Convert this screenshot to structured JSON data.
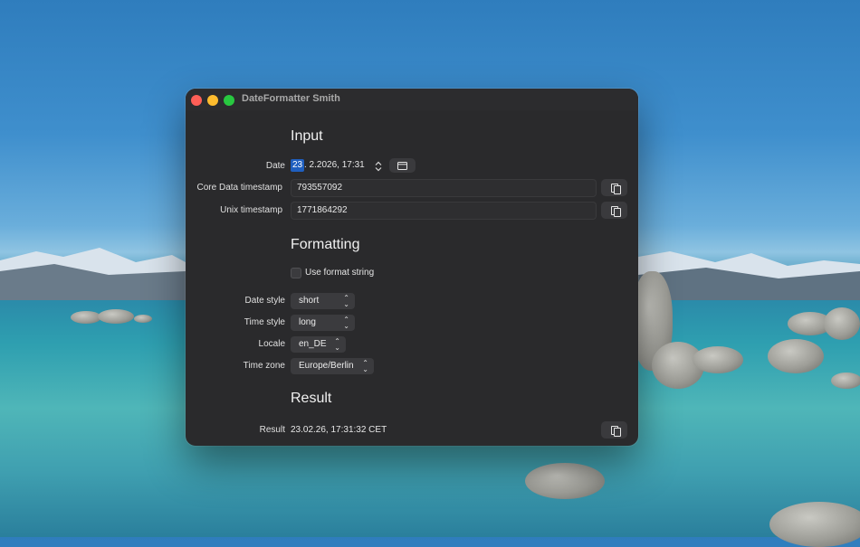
{
  "window": {
    "title": "DateFormatter Smith"
  },
  "input": {
    "heading": "Input",
    "date_label": "Date",
    "date_day": "23",
    "date_rest": ". 2.2026, 17:31",
    "core_data_label": "Core Data timestamp",
    "core_data_value": "793557092",
    "unix_label": "Unix timestamp",
    "unix_value": "1771864292"
  },
  "formatting": {
    "heading": "Formatting",
    "use_format_string_label": "Use format string",
    "use_format_string_checked": false,
    "date_style_label": "Date style",
    "date_style_value": "short",
    "time_style_label": "Time style",
    "time_style_value": "long",
    "locale_label": "Locale",
    "locale_value": "en_DE",
    "time_zone_label": "Time zone",
    "time_zone_value": "Europe/Berlin"
  },
  "result": {
    "heading": "Result",
    "label": "Result",
    "value": "23.02.26, 17:31:32 CET"
  },
  "colors": {
    "close": "#ff5f57",
    "minimize": "#febc2e",
    "maximize": "#28c840",
    "selection": "#1f5fbf"
  },
  "icons": [
    "calendar-icon",
    "copy-icon",
    "stepper-icon",
    "chevron-updown-icon",
    "checkbox-icon"
  ]
}
